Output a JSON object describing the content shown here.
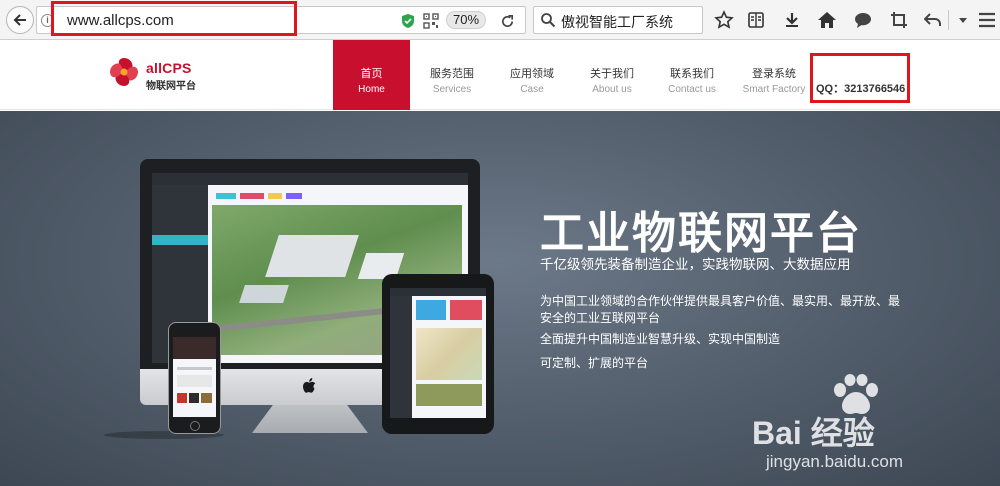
{
  "browser": {
    "url": "www.allcps.com",
    "zoom": "70%",
    "search": "傲视智能工厂系统"
  },
  "site": {
    "logo": {
      "name_en_red": "allCPS",
      "name_cn": "物联网平台"
    },
    "nav": [
      {
        "cn": "首页",
        "en": "Home",
        "active": true
      },
      {
        "cn": "服务范围",
        "en": "Services"
      },
      {
        "cn": "应用领域",
        "en": "Case"
      },
      {
        "cn": "关于我们",
        "en": "About us"
      },
      {
        "cn": "联系我们",
        "en": "Contact us"
      },
      {
        "cn": "登录系统",
        "en": "Smart Factory"
      }
    ],
    "qq": "QQ：3213766546"
  },
  "hero": {
    "title": "工业物联网平台",
    "subtitle": "千亿级领先装备制造企业，实践物联网、大数据应用",
    "lines": [
      "为中国工业领域的合作伙伴提供最具客户价值、最实用、最开放、最安全的工业互联网平台",
      "全面提升中国制造业智慧升级、实现中国制造",
      "可定制、扩展的平台"
    ]
  },
  "watermark": {
    "brand": "Bai 经验",
    "url": "jingyan.baidu.com"
  },
  "colors": {
    "brand_red": "#c8102e",
    "highlight_red": "#e0161e"
  },
  "icons": [
    "back-icon",
    "info-icon",
    "shield-icon",
    "qr-icon",
    "reload-icon",
    "search-icon",
    "star-icon",
    "reading-list-icon",
    "download-icon",
    "home-icon",
    "chat-icon",
    "crop-icon",
    "undo-icon",
    "menu-dropdown-icon"
  ]
}
